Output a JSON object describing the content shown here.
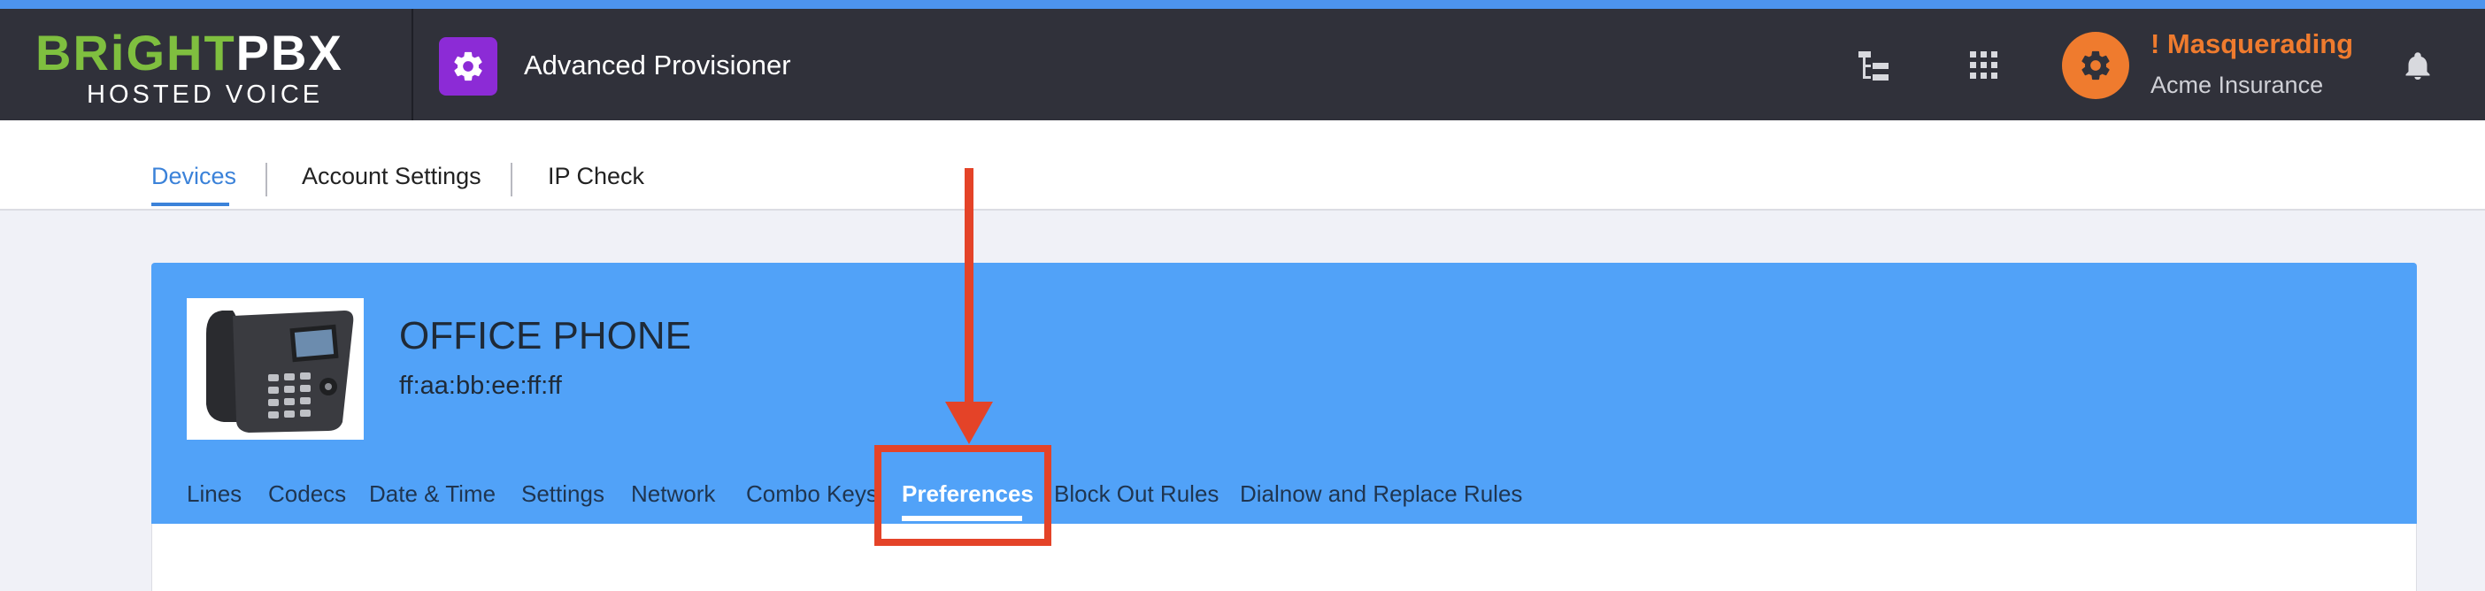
{
  "brand": {
    "logo_primary_a": "BRiGHT",
    "logo_primary_b": "PBX",
    "logo_secondary": "HOSTED VOICE",
    "colors": {
      "logo_green": "#7fbf3f",
      "accent_blue": "#4d94ee",
      "header_bg": "#30313a"
    }
  },
  "header": {
    "app_icon": "gear-icon",
    "app_icon_color": "#8c2bd6",
    "app_title": "Advanced Provisioner",
    "icons": [
      "hierarchy-icon",
      "apps-grid-icon",
      "gear-icon",
      "bell-icon"
    ],
    "masquerade": {
      "title": "! Masquerading",
      "subtitle": "Acme Insurance",
      "color": "#ef7b2e"
    }
  },
  "subnav": {
    "items": [
      {
        "label": "Devices",
        "active": true
      },
      {
        "label": "Account Settings",
        "active": false
      },
      {
        "label": "IP Check",
        "active": false
      }
    ]
  },
  "device": {
    "name": "OFFICE PHONE",
    "mac": "ff:aa:bb:ee:ff:ff",
    "image": "desk-phone-image",
    "header_color": "#51a2f8",
    "tabs": [
      {
        "label": "Lines",
        "active": false
      },
      {
        "label": "Codecs",
        "active": false
      },
      {
        "label": "Date & Time",
        "active": false
      },
      {
        "label": "Settings",
        "active": false
      },
      {
        "label": "Network",
        "active": false
      },
      {
        "label": "Combo Keys",
        "active": false
      },
      {
        "label": "Preferences",
        "active": true
      },
      {
        "label": "Block Out Rules",
        "active": false
      },
      {
        "label": "Dialnow and Replace Rules",
        "active": false
      }
    ]
  },
  "annotation": {
    "type": "arrow-and-box",
    "target": "Preferences",
    "color": "#e44328"
  }
}
